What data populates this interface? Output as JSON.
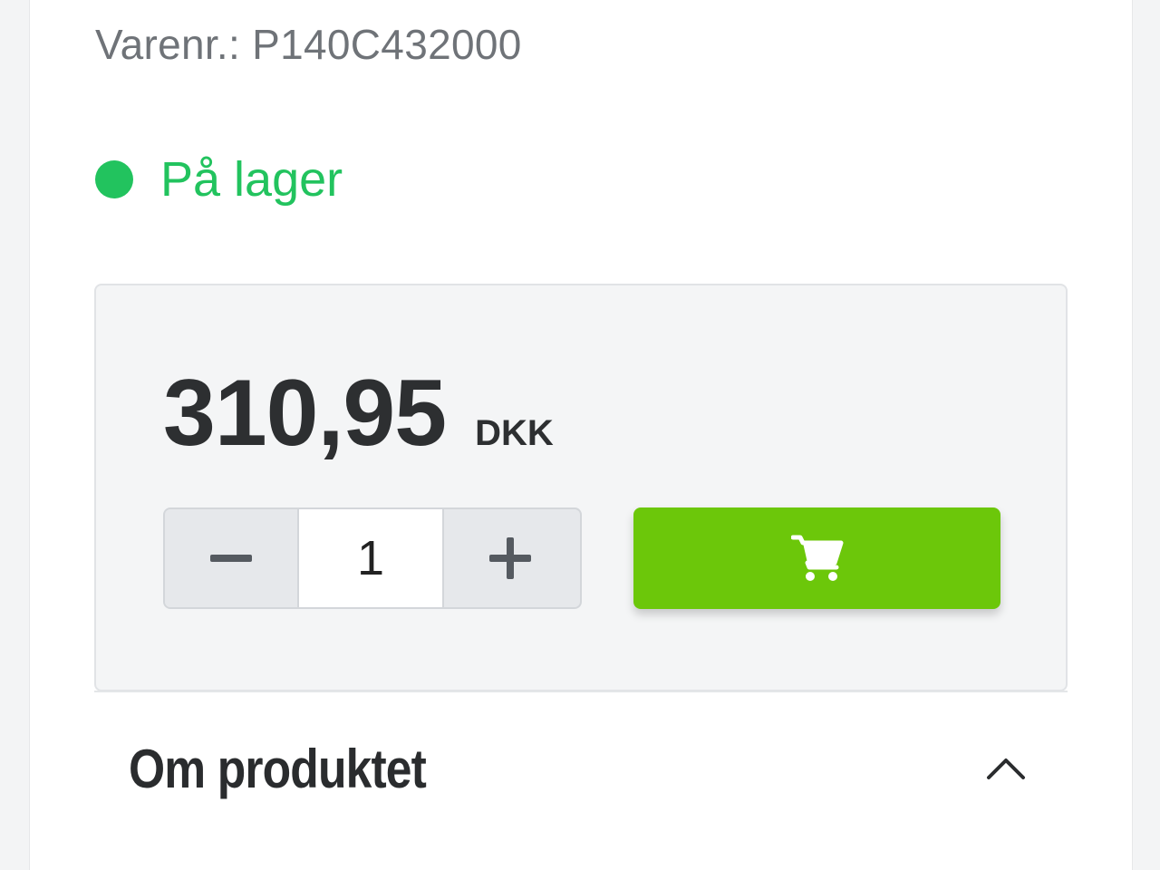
{
  "product": {
    "sku_text": "Varenr.: P140C432000",
    "stock_label": "På lager",
    "stock_color": "#22c35e"
  },
  "price": {
    "amount": "310,95",
    "currency": "DKK"
  },
  "quantity": {
    "value": "1",
    "decrement_icon": "minus-icon",
    "increment_icon": "plus-icon"
  },
  "cart_button": {
    "icon": "cart-icon",
    "color": "#6cc70a"
  },
  "section": {
    "title": "Om produktet",
    "toggle_icon": "chevron-up-icon"
  }
}
